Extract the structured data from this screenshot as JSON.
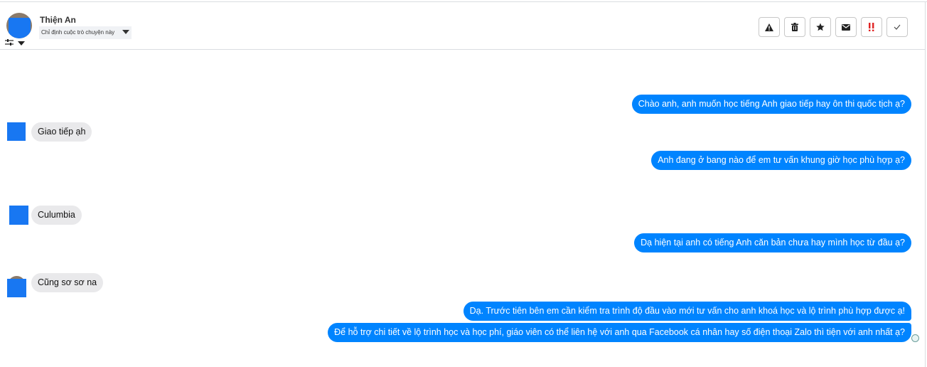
{
  "header": {
    "contact_name": "Thiện An",
    "assign_label": "Chỉ định cuộc trò chuyện này"
  },
  "toolbar": {
    "buttons": [
      {
        "name": "warning-icon"
      },
      {
        "name": "trash-icon"
      },
      {
        "name": "star-icon"
      },
      {
        "name": "envelope-icon"
      },
      {
        "name": "priority-icon",
        "color": "#e02424"
      },
      {
        "name": "check-icon"
      }
    ]
  },
  "messages": [
    {
      "direction": "out",
      "text": "Chào anh, anh muốn học tiếng Anh giao tiếp hay ôn thi quốc tịch ạ?"
    },
    {
      "direction": "in",
      "text": "Giao tiếp ạh"
    },
    {
      "direction": "out",
      "text": "Anh đang ở bang nào để em tư vấn khung giờ học phù hợp ạ?"
    },
    {
      "direction": "in",
      "text": "Culumbia"
    },
    {
      "direction": "out",
      "text": "Dạ hiện tại anh có tiếng Anh căn bản chưa hay mình học từ đầu ạ?"
    },
    {
      "direction": "in",
      "text": "Cũng sơ sơ na"
    },
    {
      "direction": "out",
      "text": "Dạ. Trước tiên bên em cần kiểm tra trình độ đầu vào mới tư vấn cho anh khoá học và lộ trình phù hợp được ạ!"
    },
    {
      "direction": "out",
      "text": "Để hỗ trợ chi tiết về lộ trình học và học phí, giáo viên có thể liên hệ với anh qua Facebook cá nhân hay số điện thoại Zalo thì tiện với anh nhất ạ?"
    }
  ],
  "colors": {
    "outgoing_bubble": "#0084ff",
    "incoming_bubble": "#e9e9eb",
    "avatar_placeholder": "#1877f2"
  }
}
